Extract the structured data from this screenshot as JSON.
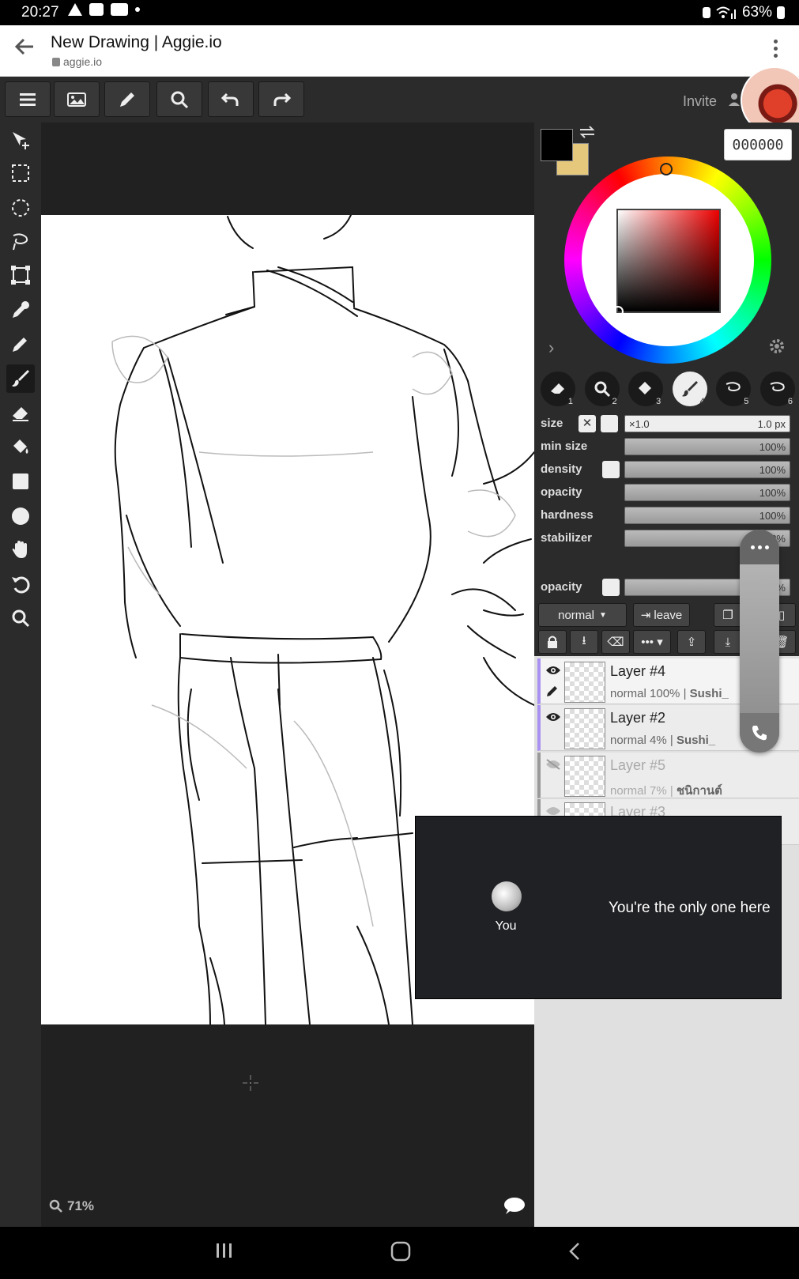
{
  "status_bar": {
    "time": "20:27",
    "battery": "63%"
  },
  "browser": {
    "title": "New Drawing | Aggie.io",
    "url": "aggie.io"
  },
  "toolbar": {
    "invite_label": "Invite"
  },
  "color": {
    "hex_value": "000000",
    "primary": "#000000",
    "secondary": "#e6c87c"
  },
  "brush_slots": [
    "1",
    "2",
    "3",
    "4",
    "5",
    "6"
  ],
  "properties": {
    "size_label": "size",
    "size_multiplier": "×1.0",
    "size_value": "1.0 px",
    "min_size_label": "min size",
    "min_size_value": "100%",
    "density_label": "density",
    "density_value": "100%",
    "opacity_label": "opacity",
    "opacity_value": "100%",
    "hardness_label": "hardness",
    "hardness_value": "100%",
    "stabilizer_label": "stabilizer",
    "stabilizer_value": "3%",
    "layer_opacity_label": "opacity",
    "layer_opacity_value": "0%"
  },
  "layer_controls": {
    "blend_mode": "normal",
    "leave_label": "leave"
  },
  "layers": [
    {
      "name": "Layer #4",
      "mode": "normal",
      "opacity": "100%",
      "owner": "Sushi_"
    },
    {
      "name": "Layer #2",
      "mode": "normal",
      "opacity": "4%",
      "owner": "Sushi_"
    },
    {
      "name": "Layer #5",
      "mode": "normal",
      "opacity": "7%",
      "owner": "ชนิกานต์"
    },
    {
      "name": "Layer #3",
      "mode": "",
      "opacity": "",
      "owner": ""
    }
  ],
  "canvas": {
    "zoom": "71%"
  },
  "call": {
    "you_label": "You",
    "message": "You're the only one here"
  }
}
